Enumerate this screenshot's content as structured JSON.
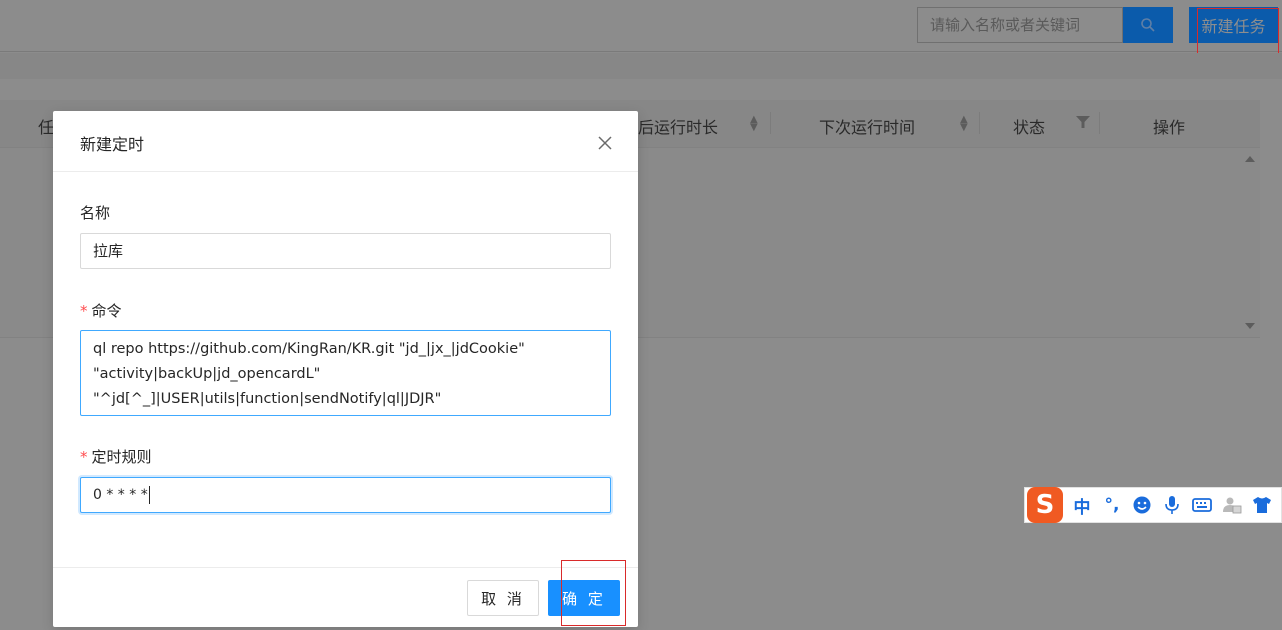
{
  "header": {
    "search_placeholder": "请输入名称或者关键词",
    "new_task_label": "新建任务"
  },
  "table": {
    "columns": [
      {
        "label": "任"
      },
      {
        "label": "最后运行时长"
      },
      {
        "label": "下次运行时间"
      },
      {
        "label": "状态"
      },
      {
        "label": "操作"
      }
    ]
  },
  "modal": {
    "title": "新建定时",
    "name_label": "名称",
    "name_value": "拉库",
    "command_label": "命令",
    "command_value": "ql repo https://github.com/KingRan/KR.git \"jd_|jx_|jdCookie\"\n\"activity|backUp|jd_opencardL\"\n\"^jd[^_]|USER|utils|function|sendNotify|ql|JDJR\"",
    "cron_label": "定时规则",
    "cron_value": "0 * * * *",
    "cancel_label": "取 消",
    "ok_label": "确 定",
    "required_mark": "*"
  },
  "ime": {
    "logo": "S",
    "mode": "中",
    "punct": "°,",
    "items": [
      "emoji-icon",
      "microphone-icon",
      "keyboard-icon",
      "user-card-icon",
      "skin-icon"
    ]
  },
  "colors": {
    "primary": "#1890ff",
    "annotation_red": "#d92a2a",
    "ime_orange": "#f05a22",
    "ime_blue": "#1a6cdc"
  }
}
